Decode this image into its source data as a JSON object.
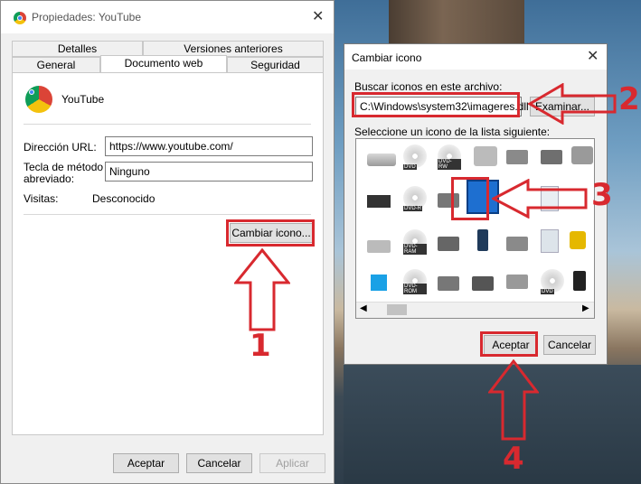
{
  "dialog1": {
    "title": "Propiedades: YouTube",
    "tabs_row1": [
      "Detalles",
      "Versiones anteriores"
    ],
    "tabs_row2": [
      "General",
      "Documento web",
      "Seguridad"
    ],
    "active_tab": "Documento web",
    "app_name": "YouTube",
    "url_label": "Dirección URL:",
    "url_value": "https://www.youtube.com/",
    "shortcut_label_1": "Tecla de método",
    "shortcut_label_2": "abreviado:",
    "shortcut_value": "Ninguno",
    "visits_label": "Visitas:",
    "visits_value": "Desconocido",
    "change_icon_button": "Cambiar icono...",
    "ok_button": "Aceptar",
    "cancel_button": "Cancelar",
    "apply_button": "Aplicar"
  },
  "dialog2": {
    "title": "Cambiar icono",
    "search_label": "Buscar iconos en este archivo:",
    "file_path": "C:\\Windows\\system32\\imageres.dll",
    "browse_button": "Examinar...",
    "list_label": "Seleccione un icono de la lista siguiente:",
    "ok_button": "Aceptar",
    "cancel_button": "Cancelar",
    "icon_labels": [
      "DVD",
      "DVD-RW",
      "DVD-R",
      "DVD-RAM",
      "DVD-ROM",
      "DVD",
      "CD",
      "CD"
    ]
  },
  "annotations": {
    "step_numbers": [
      "1",
      "2",
      "3",
      "4"
    ],
    "color": "#d8292f"
  },
  "icons": [
    "chrome-icon",
    "close-icon",
    "scroll-left-icon",
    "scroll-right-icon"
  ]
}
